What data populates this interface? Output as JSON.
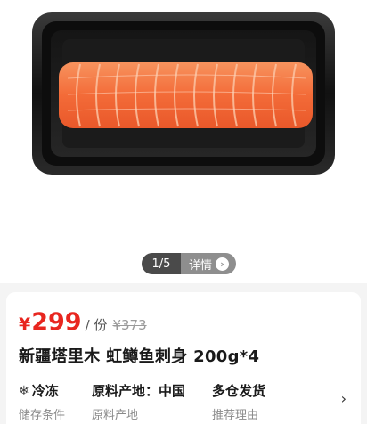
{
  "pager": {
    "count": "1/5",
    "detail_label": "详情",
    "detail_icon": "chevron-right-icon"
  },
  "price": {
    "currency": "¥",
    "current": "299",
    "unit": "/ 份",
    "original": "¥373"
  },
  "product": {
    "title": "新疆塔里木 虹鳟鱼刺身 200g*4"
  },
  "attributes": [
    {
      "icon": "snowflake-icon",
      "value": "冷冻",
      "key": "储存条件"
    },
    {
      "value": "原料产地：中国",
      "key": "原料产地"
    },
    {
      "value": "多仓发货",
      "key": "推荐理由"
    }
  ],
  "colors": {
    "accent": "#e8261f",
    "salmon": "#f4703d",
    "tray": "#1c1c1c"
  }
}
